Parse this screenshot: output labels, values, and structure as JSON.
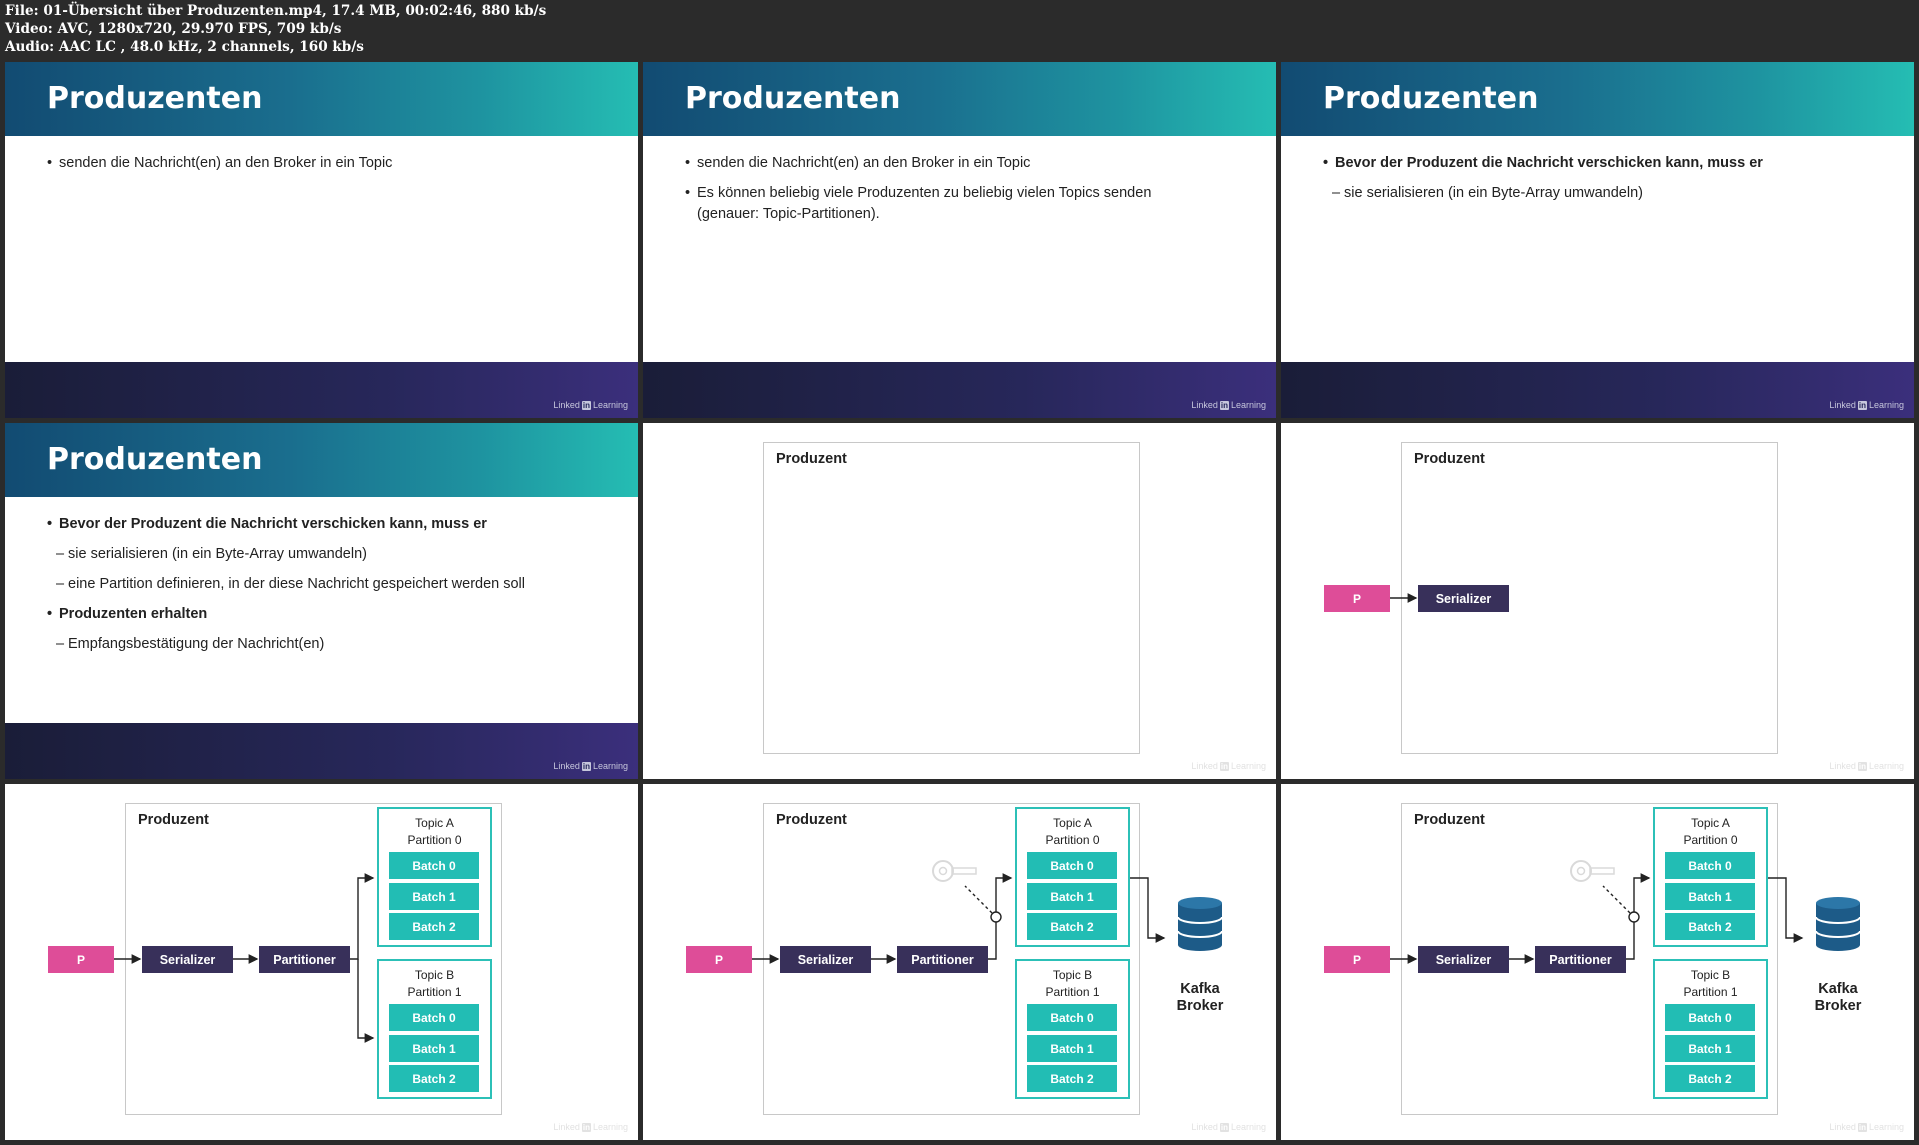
{
  "file_info": {
    "line1": "File: 01-Übersicht über Produzenten.mp4, 17.4 MB, 00:02:46, 880 kb/s",
    "line2": "Video: AVC, 1280x720, 29.970 FPS, 709 kb/s",
    "line3": "Audio: AAC LC , 48.0 kHz, 2 channels, 160 kb/s"
  },
  "brand": {
    "pre": "Linked",
    "in": "in",
    "post": "Learning"
  },
  "slide_title": "Produzenten",
  "text": {
    "send": "senden die Nachricht(en) an den Broker in ein Topic",
    "many": "Es können beliebig viele Produzenten zu beliebig vielen Topics senden (genauer: Topic-Partitionen).",
    "before": "Bevor der Produzent die Nachricht verschicken kann, muss er",
    "serialize": "sie serialisieren (in ein Byte-Array umwandeln)",
    "partition": "eine Partition definieren, in der diese Nachricht gespeichert werden soll",
    "receive": "Produzenten erhalten",
    "ack": "Empfangsbestätigung der Nachricht(en)"
  },
  "diagram": {
    "frame_label": "Produzent",
    "producer": "P",
    "serializer": "Serializer",
    "partitioner": "Partitioner",
    "topic_a_line1": "Topic A",
    "topic_a_line2": "Partition 0",
    "topic_b_line1": "Topic B",
    "topic_b_line2": "Partition 1",
    "batch0": "Batch 0",
    "batch1": "Batch 1",
    "batch2": "Batch 2",
    "broker_line1": "Kafka",
    "broker_line2": "Broker"
  },
  "colors": {
    "producer_box": "#de4d98",
    "dark_box": "#38305a",
    "batch": "#22bdb4",
    "topic_border": "#2cc0b7",
    "broker_db": "#1d5b88"
  }
}
